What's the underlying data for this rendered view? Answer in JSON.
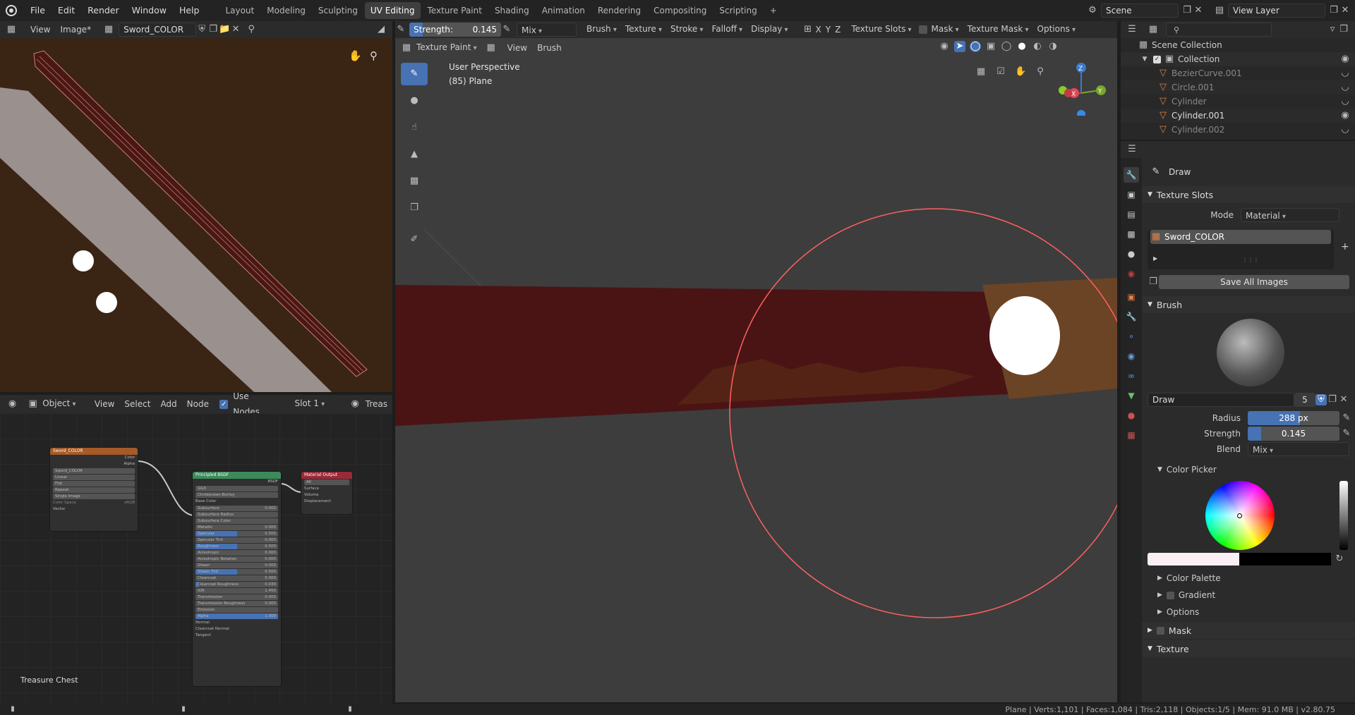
{
  "topbar": {
    "menus": [
      "File",
      "Edit",
      "Render",
      "Window",
      "Help"
    ],
    "workspaces": [
      "Layout",
      "Modeling",
      "Sculpting",
      "UV Editing",
      "Texture Paint",
      "Shading",
      "Animation",
      "Rendering",
      "Compositing",
      "Scripting"
    ],
    "active_workspace": "UV Editing",
    "add_tab": "+",
    "scene": "Scene",
    "view_layer": "View Layer"
  },
  "image_editor": {
    "view": "View",
    "image_menu": "Image*",
    "image_name": "Sword_COLOR"
  },
  "viewport": {
    "strength_label": "Strength:",
    "strength_value": "0.145",
    "blend": "Mix",
    "menus": [
      "Brush",
      "Texture",
      "Stroke",
      "Falloff",
      "Display"
    ],
    "axes": [
      "X",
      "Y",
      "Z"
    ],
    "texture_slots": "Texture Slots",
    "mask": "Mask",
    "texture_mask": "Texture Mask",
    "options": "Options",
    "mode": "Texture Paint",
    "view": "View",
    "brush": "Brush",
    "perspective": "User Perspective",
    "object_info": "(85) Plane",
    "gizmo_x": "X",
    "gizmo_y": "Y",
    "gizmo_z": "Z"
  },
  "node_editor": {
    "editor_mode": "Object",
    "view": "View",
    "select": "Select",
    "add": "Add",
    "node": "Node",
    "use_nodes": "Use Nodes",
    "slot": "Slot 1",
    "material": "Treas",
    "footer_label": "Treasure Chest",
    "image_node": {
      "title": "Sword_COLOR",
      "outputs": [
        "Color",
        "Alpha"
      ],
      "image": "Sword_COLOR",
      "options": [
        "Linear",
        "Flat",
        "Repeat",
        "Single Image"
      ],
      "color_space_label": "Color Space",
      "color_space": "sRGB",
      "vector": "Vector"
    },
    "bsdf_node": {
      "title": "Principled BSDF",
      "output": "BSDF",
      "distribution": "GGX",
      "subsurface_method": "Christensen-Burley",
      "base_color": "Base Color",
      "rows": [
        {
          "label": "Subsurface",
          "value": "0.000",
          "fill": 0
        },
        {
          "label": "Subsurface Radius",
          "value": "",
          "fill": 0
        },
        {
          "label": "Subsurface Color",
          "value": "",
          "fill": 0
        },
        {
          "label": "Metallic",
          "value": "0.000",
          "fill": 0
        },
        {
          "label": "Specular",
          "value": "0.500",
          "fill": 0.5
        },
        {
          "label": "Specular Tint",
          "value": "0.000",
          "fill": 0
        },
        {
          "label": "Roughness",
          "value": "0.500",
          "fill": 0.5
        },
        {
          "label": "Anisotropic",
          "value": "0.000",
          "fill": 0
        },
        {
          "label": "Anisotropic Rotation",
          "value": "0.000",
          "fill": 0
        },
        {
          "label": "Sheen",
          "value": "0.000",
          "fill": 0
        },
        {
          "label": "Sheen Tint",
          "value": "0.500",
          "fill": 0.5
        },
        {
          "label": "Clearcoat",
          "value": "0.000",
          "fill": 0
        },
        {
          "label": "Clearcoat Roughness",
          "value": "0.030",
          "fill": 0.03
        },
        {
          "label": "IOR",
          "value": "1.450",
          "fill": 0
        },
        {
          "label": "Transmission",
          "value": "0.000",
          "fill": 0
        },
        {
          "label": "Transmission Roughness",
          "value": "0.000",
          "fill": 0
        },
        {
          "label": "Emission",
          "value": "",
          "fill": 0
        },
        {
          "label": "Alpha",
          "value": "1.000",
          "fill": 1
        }
      ],
      "sockets": [
        "Normal",
        "Clearcoat Normal",
        "Tangent"
      ]
    },
    "output_node": {
      "title": "Material Output",
      "target": "All",
      "inputs": [
        "Surface",
        "Volume",
        "Displacement"
      ]
    }
  },
  "outliner": {
    "root": "Scene Collection",
    "collection": "Collection",
    "items": [
      "BezierCurve.001",
      "Circle.001",
      "Cylinder",
      "Cylinder.001",
      "Cylinder.002"
    ]
  },
  "properties": {
    "tool_name": "Draw",
    "texture_slots_title": "Texture Slots",
    "mode_label": "Mode",
    "mode_value": "Material",
    "slot_item": "Sword_COLOR",
    "save_all": "Save All Images",
    "brush_title": "Brush",
    "brush_name": "Draw",
    "brush_users": "5",
    "radius_label": "Radius",
    "radius_value": "288 px",
    "radius_fill": 0.57,
    "strength_label": "Strength",
    "strength_value": "0.145",
    "strength_fill": 0.145,
    "blend_label": "Blend",
    "blend_value": "Mix",
    "color_picker": "Color Picker",
    "color_palette": "Color Palette",
    "gradient": "Gradient",
    "options": "Options",
    "mask": "Mask",
    "texture": "Texture"
  },
  "statusbar": {
    "stats": "Plane | Verts:1,101 | Faces:1,084 | Tris:2,118 | Objects:1/5 | Mem: 91.0 MB | v2.80.75"
  },
  "colors": {
    "accent": "#4772b3",
    "brush_circle": "#ff4d4d",
    "image_bg": "#3a2414",
    "sword_blade": "#9a908e"
  }
}
